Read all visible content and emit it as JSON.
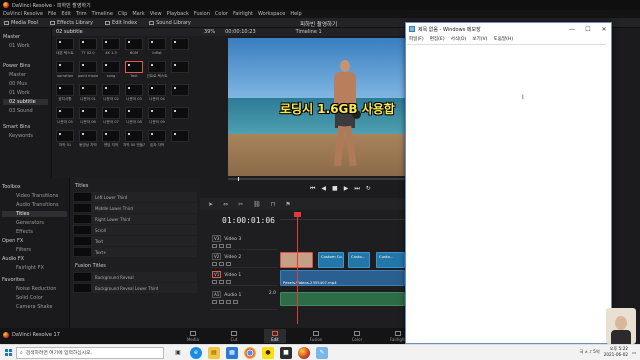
{
  "resolve": {
    "window_title": "DaVinci Resolve - 피하빈 촬영하기",
    "menu": [
      "DaVinci Resolve",
      "File",
      "Edit",
      "Trim",
      "Timeline",
      "Clip",
      "Mark",
      "View",
      "Playback",
      "Fusion",
      "Color",
      "Fairlight",
      "Workspace",
      "Help"
    ],
    "toolbar": {
      "media_pool": "Media Pool",
      "effects_library": "Effects Library",
      "edit_index": "Edit Index",
      "sound_library": "Sound Library"
    },
    "project_title": "피하빈 촬영하기",
    "bins": {
      "master_label": "Master",
      "master_items": [
        "01 Work"
      ],
      "power_bins_label": "Power Bins",
      "power_items": [
        "Master",
        "00 Mus",
        "01 Work",
        "02 subtitle",
        "03 Sound"
      ],
      "smart_bins_label": "Smart Bins",
      "smart_items": [
        "Keywords"
      ]
    },
    "bin_header": "02 subtitle",
    "clips": [
      "대본 텍스트",
      "TT 02.0",
      "4K 1.5",
      "BGM",
      "Inflat",
      "",
      "narration",
      "point move",
      "song",
      "Text",
      "인트로 텍스트",
      "",
      "공지사항",
      "나운아 01",
      "나운아 02",
      "나운아 03",
      "나운아 04",
      "",
      "나운아 05",
      "나운아 06",
      "나운아 07",
      "나운아 08",
      "나운아 09",
      "",
      "자막 01",
      "동영상 자막",
      "엔딩 자막",
      "자막 00 만들기",
      "효과 자막",
      ""
    ],
    "selected_clip_index": 9,
    "effects_tree": {
      "toolbox_label": "Toolbox",
      "toolbox_items": [
        "Video Transitions",
        "Audio Transitions",
        "Titles",
        "Generators",
        "Effects"
      ],
      "selected_index": 2,
      "openfx_label": "Open FX",
      "openfx_items": [
        "Filters"
      ],
      "audiofx_label": "Audio FX",
      "audiofx_items": [
        "Fairlight FX"
      ],
      "favorites_label": "Favorites",
      "favorites_items": [
        "Noise Reduction",
        "Solid Color",
        "Camera Shake"
      ]
    },
    "titles_header": "Titles",
    "titles": [
      "Left Lower Third",
      "Middle Lower Third",
      "Right Lower Third",
      "Scroll",
      "Text",
      "Text+"
    ],
    "fusion_header": "Fusion Titles",
    "fusion_titles": [
      "Background Reveal",
      "Background Reveal Lower Third"
    ],
    "viewer": {
      "zoom": "39%",
      "timecode": "00:00:10:23",
      "timeline_name": "Timeline 1"
    },
    "subtitle_overlay": "로딩시 1.6GB 사용합",
    "transport": [
      "⏮",
      "◀",
      "■",
      "▶",
      "⏭",
      "↻"
    ],
    "timeline": {
      "timecode": "01:00:01:06",
      "tracks": [
        {
          "tag": "V3",
          "name": "Video 3"
        },
        {
          "tag": "V2",
          "name": "Video 2"
        },
        {
          "tag": "V1",
          "name": "Video 1"
        },
        {
          "tag": "A1",
          "name": "Audio 1",
          "level": "2.0"
        }
      ],
      "clip_video": "Pexels-Videos-2355407.mp4",
      "clip_titles": [
        "",
        "Custom Co...",
        "Custo...",
        "Custo..."
      ]
    },
    "pages": [
      "Media",
      "Cut",
      "Edit",
      "Fusion",
      "Color",
      "Fairlight"
    ],
    "active_page": "Edit",
    "logo_text": "DaVinci Resolve 17"
  },
  "notepad": {
    "title": "제목 없음 - Windows 메모장",
    "menu": [
      "파일(F)",
      "편집(E)",
      "서식(O)",
      "보기(V)",
      "도움말(H)"
    ],
    "controls": [
      "—",
      "☐",
      "✕"
    ]
  },
  "taskbar": {
    "search_placeholder": "검색하려면 여기에 입력하십시오.",
    "tray_text": "국 ∧ ♪ 5억",
    "time": "오후 5:22",
    "date": "2021-06-02"
  },
  "colors": {
    "accent": "#e05a4a",
    "title_clip": "#2276a8",
    "audio_clip": "#2e6b47",
    "subtitle": "#ffe94a"
  }
}
